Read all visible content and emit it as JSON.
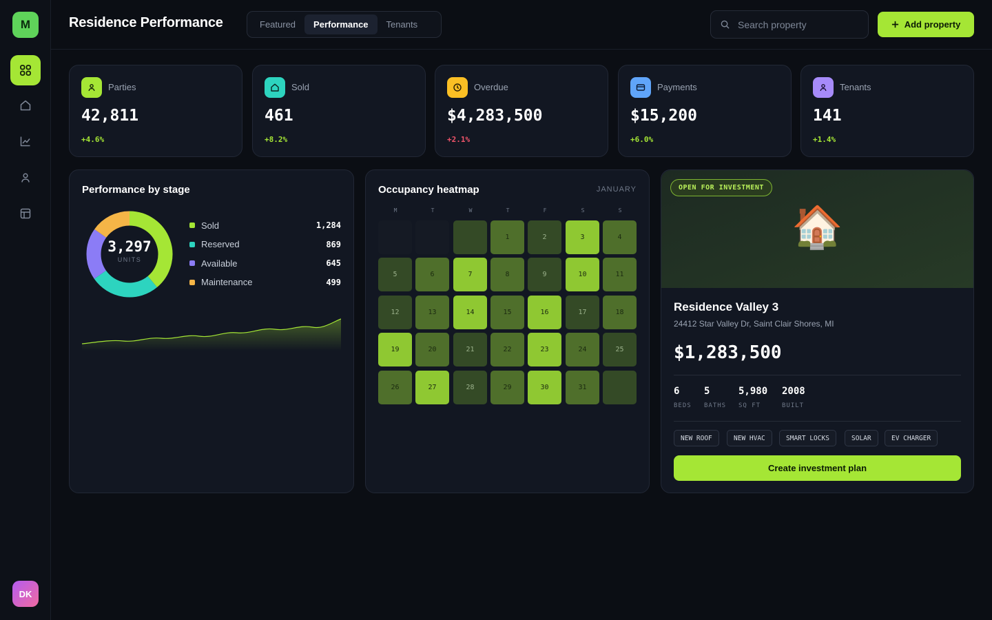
{
  "sidebar": {
    "logo_letter": "M",
    "avatar_initials": "DK",
    "items": [
      {
        "icon": "grid-icon",
        "active": true
      },
      {
        "icon": "home-icon",
        "active": false
      },
      {
        "icon": "chart-line-icon",
        "active": false
      },
      {
        "icon": "user-icon",
        "active": false
      },
      {
        "icon": "calendar-icon",
        "active": false
      }
    ]
  },
  "header": {
    "title": "Residence Performance",
    "tabs": [
      {
        "label": "Featured",
        "active": false
      },
      {
        "label": "Performance",
        "active": true
      },
      {
        "label": "Tenants",
        "active": false
      }
    ],
    "search_placeholder": "Search property",
    "add_button": "Add property"
  },
  "stats": [
    {
      "label": "Parties",
      "value": "42,811",
      "change": "+4.6%",
      "trend": "up",
      "icon": "user-icon",
      "color": "#a5e635"
    },
    {
      "label": "Sold",
      "value": "461",
      "change": "+8.2%",
      "trend": "up",
      "icon": "home-icon",
      "color": "#2dd4bf"
    },
    {
      "label": "Overdue",
      "value": "$4,283,500",
      "change": "+2.1%",
      "trend": "down",
      "icon": "clock-icon",
      "color": "#fbbf24"
    },
    {
      "label": "Payments",
      "value": "$15,200",
      "change": "+6.0%",
      "trend": "up",
      "icon": "card-icon",
      "color": "#60a5fa"
    },
    {
      "label": "Tenants",
      "value": "141",
      "change": "+1.4%",
      "trend": "up",
      "icon": "user-icon",
      "color": "#a78bfa"
    }
  ],
  "performance": {
    "title": "Performance by stage",
    "total": "3,297",
    "total_label": "UNITS"
  },
  "chart_data": {
    "type": "pie",
    "categories": [
      "Sold",
      "Reserved",
      "Available",
      "Maintenance"
    ],
    "values": [
      1284,
      869,
      645,
      499
    ],
    "colors": [
      "#a5e635",
      "#2dd4bf",
      "#8b7cf6",
      "#f5b547"
    ],
    "donut": true,
    "center_value": 3297,
    "center_label": "UNITS",
    "legend": "right"
  },
  "heatmap": {
    "title": "Occupancy heatmap",
    "month": "JANUARY",
    "weekdays": [
      "M",
      "T",
      "W",
      "T",
      "F",
      "S",
      "S"
    ],
    "leading_blanks": 2,
    "days": [
      {
        "d": "",
        "level": 1
      },
      {
        "d": "1",
        "level": 2
      },
      {
        "d": "2",
        "level": 1
      },
      {
        "d": "3",
        "level": 4
      },
      {
        "d": "4",
        "level": 2
      },
      {
        "d": "5",
        "level": 1
      },
      {
        "d": "6",
        "level": 2
      },
      {
        "d": "7",
        "level": 4
      },
      {
        "d": "8",
        "level": 2
      },
      {
        "d": "9",
        "level": 1
      },
      {
        "d": "10",
        "level": 4
      },
      {
        "d": "11",
        "level": 2
      },
      {
        "d": "12",
        "level": 1
      },
      {
        "d": "13",
        "level": 2
      },
      {
        "d": "14",
        "level": 4
      },
      {
        "d": "15",
        "level": 2
      },
      {
        "d": "16",
        "level": 4
      },
      {
        "d": "17",
        "level": 1
      },
      {
        "d": "18",
        "level": 2
      },
      {
        "d": "19",
        "level": 4
      },
      {
        "d": "20",
        "level": 2
      },
      {
        "d": "21",
        "level": 1
      },
      {
        "d": "22",
        "level": 2
      },
      {
        "d": "23",
        "level": 4
      },
      {
        "d": "24",
        "level": 2
      },
      {
        "d": "25",
        "level": 1
      },
      {
        "d": "26",
        "level": 2
      },
      {
        "d": "27",
        "level": 4
      },
      {
        "d": "28",
        "level": 1
      },
      {
        "d": "29",
        "level": 2
      },
      {
        "d": "30",
        "level": 4
      },
      {
        "d": "31",
        "level": 2
      },
      {
        "d": "",
        "level": 1
      }
    ],
    "level_colors": {
      "0": "#151a24",
      "1": "#344a26",
      "2": "#4f6f2b",
      "4": "#8fc832"
    }
  },
  "property": {
    "badge": "OPEN FOR INVESTMENT",
    "emoji": "🏠",
    "name": "Residence Valley 3",
    "address": "24412 Star Valley Dr, Saint Clair Shores, MI",
    "price": "$1,283,500",
    "specs": [
      {
        "value": "6",
        "label": "BEDS"
      },
      {
        "value": "5",
        "label": "BATHS"
      },
      {
        "value": "5,980",
        "label": "SQ FT"
      },
      {
        "value": "2008",
        "label": "BUILT"
      }
    ],
    "tags": [
      "NEW ROOF",
      "NEW HVAC",
      "SMART LOCKS",
      "SOLAR",
      "EV CHARGER"
    ],
    "cta": "Create investment plan"
  }
}
